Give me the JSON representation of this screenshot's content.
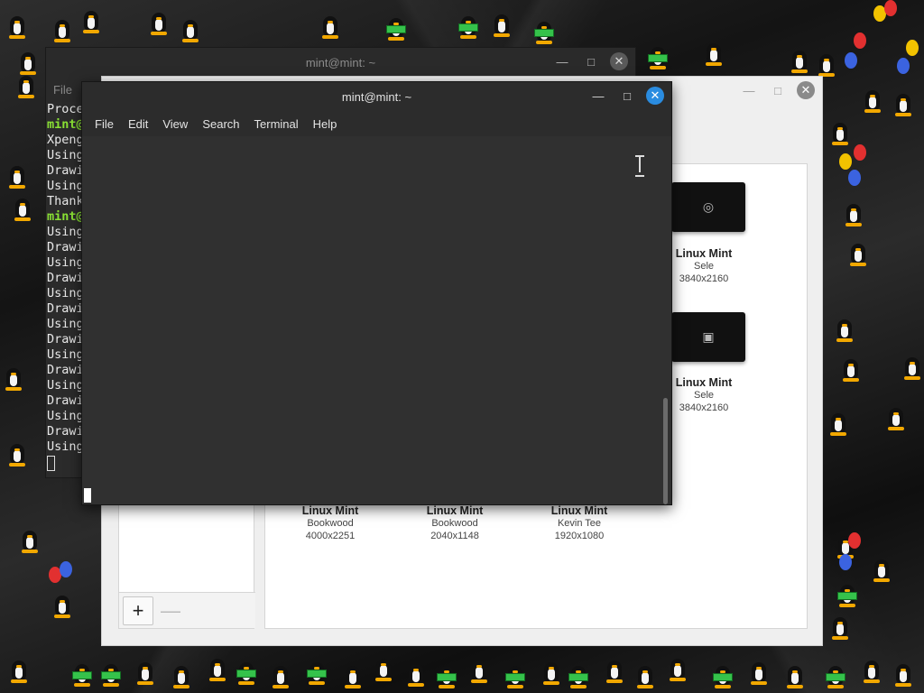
{
  "back_terminal": {
    "title": "mint@mint: ~",
    "menu_file": "File",
    "lines": [
      {
        "text": "Proce",
        "prompt": false
      },
      {
        "text": "mint@",
        "prompt": true
      },
      {
        "text": "Xpeng",
        "prompt": false
      },
      {
        "text": "Using",
        "prompt": false
      },
      {
        "text": "Drawi",
        "prompt": false
      },
      {
        "text": "Using",
        "prompt": false
      },
      {
        "text": "Thank",
        "prompt": false
      },
      {
        "text": "mint@",
        "prompt": true
      },
      {
        "text": "Using",
        "prompt": false
      },
      {
        "text": "Drawi",
        "prompt": false
      },
      {
        "text": "Using",
        "prompt": false
      },
      {
        "text": "Drawi",
        "prompt": false
      },
      {
        "text": "Using",
        "prompt": false
      },
      {
        "text": "Drawi",
        "prompt": false
      },
      {
        "text": "Using",
        "prompt": false
      },
      {
        "text": "Drawi",
        "prompt": false
      },
      {
        "text": "Using",
        "prompt": false
      },
      {
        "text": "Drawi",
        "prompt": false
      },
      {
        "text": "Using",
        "prompt": false
      },
      {
        "text": "Drawi",
        "prompt": false
      },
      {
        "text": "Using",
        "prompt": false
      },
      {
        "text": "Drawi",
        "prompt": false
      },
      {
        "text": "Using",
        "prompt": false
      }
    ]
  },
  "front_terminal": {
    "title": "mint@mint: ~",
    "menu": [
      "File",
      "Edit",
      "View",
      "Search",
      "Terminal",
      "Help"
    ],
    "close_color": "#2a8ce0"
  },
  "backgrounds_window": {
    "add_label": "+",
    "remove_label": "—",
    "items_right": [
      {
        "title": "Linux Mint",
        "author": "Sele",
        "dims": "3840x2160"
      },
      {
        "title": "Linux Mint",
        "author": "Sele",
        "dims": "3840x2160"
      }
    ],
    "items_bottom": [
      {
        "title": "Linux Mint",
        "author": "Bookwood",
        "dims": "4000x2251"
      },
      {
        "title": "Linux Mint",
        "author": "Bookwood",
        "dims": "2040x1148"
      },
      {
        "title": "Linux Mint",
        "author": "Kevin Tee",
        "dims": "1920x1080"
      }
    ]
  },
  "icons": {
    "minimize": "minimize-icon",
    "maximize": "maximize-icon",
    "close": "close-icon",
    "text_cursor": "ibeam-cursor-icon"
  }
}
